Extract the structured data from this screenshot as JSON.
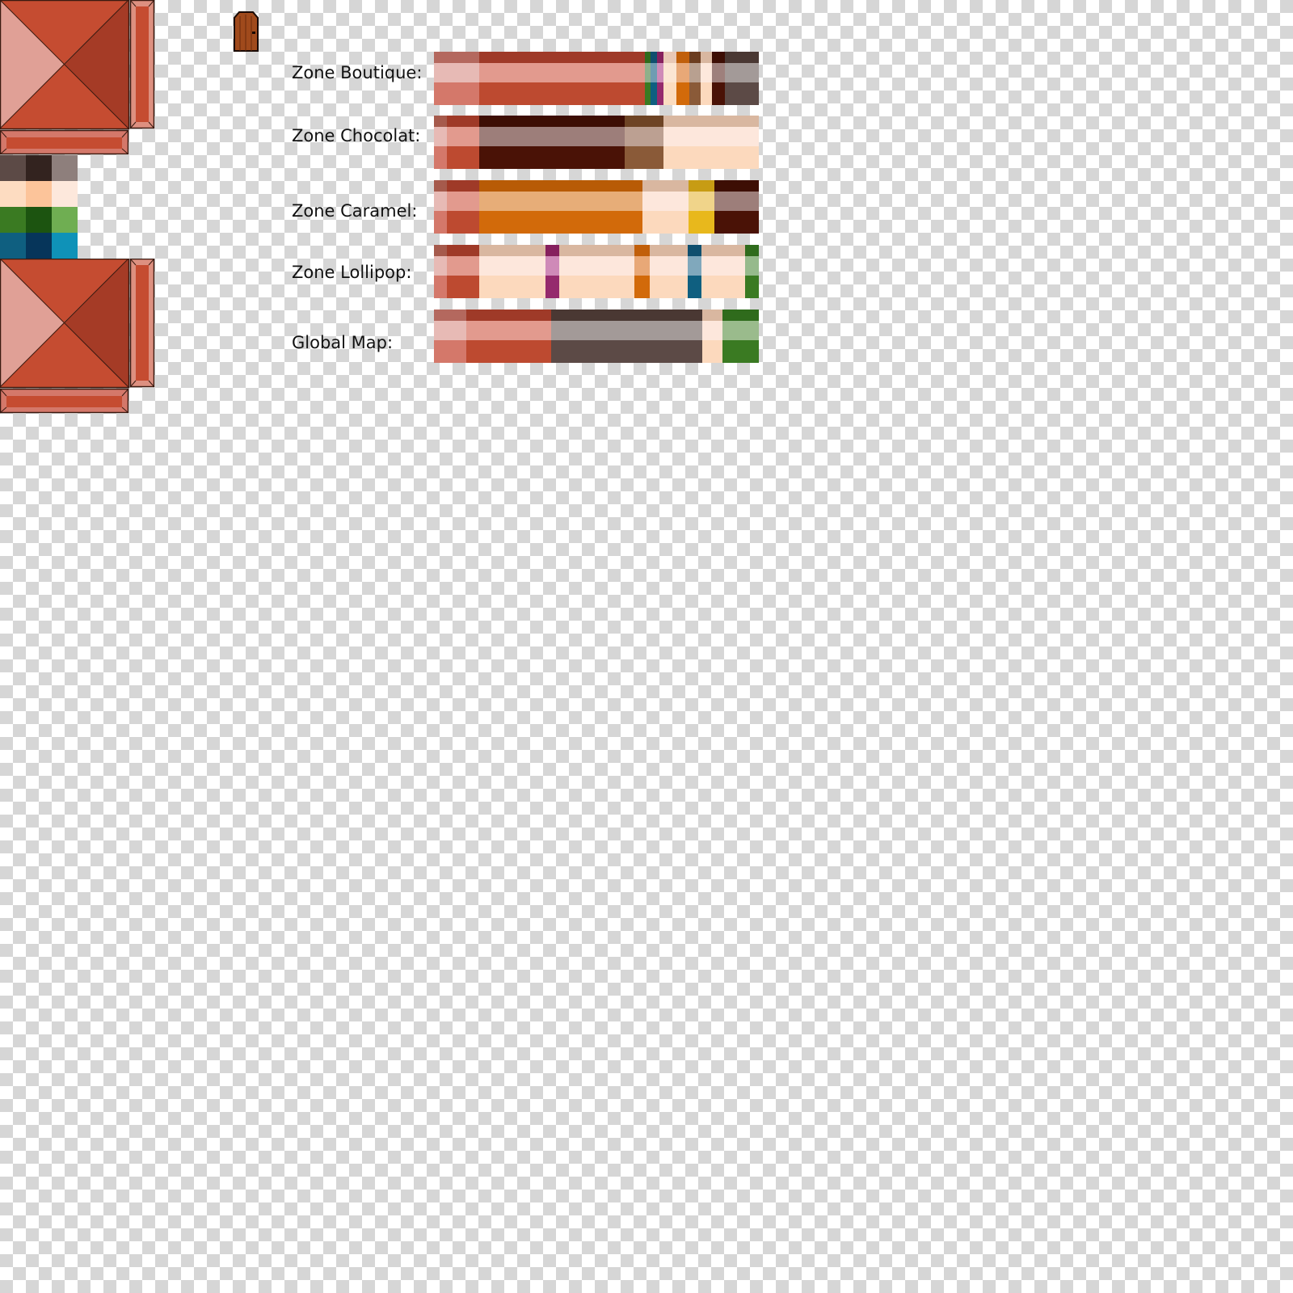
{
  "zones": [
    {
      "label": "Zone Boutique:",
      "segments": [
        {
          "w": 56,
          "top": "#b4685e",
          "mid": "#e7bab5",
          "bot": "#d4786a"
        },
        {
          "w": 205,
          "top": "#9f3a28",
          "mid": "#e29a8e",
          "bot": "#bd4a30"
        },
        {
          "w": 7,
          "top": "#2f6b1c",
          "mid": "#8fb08a",
          "bot": "#3a7a22"
        },
        {
          "w": 8,
          "top": "#0f4f6e",
          "mid": "#6f9cb2",
          "bot": "#0f5f80"
        },
        {
          "w": 8,
          "top": "#86205e",
          "mid": "#cf8ab8",
          "bot": "#952a6d"
        },
        {
          "w": 16,
          "top": "#e8c8b6",
          "mid": "#fbe5d3",
          "bot": "#fbdcc0"
        },
        {
          "w": 16,
          "top": "#c15f0a",
          "mid": "#e8a877",
          "bot": "#d26a0a"
        },
        {
          "w": 14,
          "top": "#6b3d20",
          "mid": "#b8a090",
          "bot": "#8a5a38"
        },
        {
          "w": 14,
          "top": "#d9b7a0",
          "mid": "#fde8dc",
          "bot": "#fcd9bd"
        },
        {
          "w": 16,
          "top": "#3d0e04",
          "mid": "#9e807c",
          "bot": "#4a1206"
        },
        {
          "w": 42,
          "top": "#4a3833",
          "mid": "#a39a98",
          "bot": "#5c4a46"
        }
      ]
    },
    {
      "label": "Zone Chocolat:",
      "segments": [
        {
          "w": 16,
          "top": "#a65a4c",
          "mid": "#e7bab5",
          "bot": "#d4786a"
        },
        {
          "w": 40,
          "top": "#9f3a28",
          "mid": "#e29a8e",
          "bot": "#bd4a30"
        },
        {
          "w": 180,
          "top": "#3d0e04",
          "mid": "#9d7e7a",
          "bot": "#4a1206"
        },
        {
          "w": 48,
          "top": "#6e4425",
          "mid": "#bca092",
          "bot": "#8a5a38"
        },
        {
          "w": 118,
          "top": "#d9b7a0",
          "mid": "#fde7dc",
          "bot": "#fcd9bd"
        }
      ]
    },
    {
      "label": "Zone Caramel:",
      "segments": [
        {
          "w": 16,
          "top": "#a65a4c",
          "mid": "#e7bab5",
          "bot": "#d4786a"
        },
        {
          "w": 40,
          "top": "#9f3a28",
          "mid": "#e29a8e",
          "bot": "#bd4a30"
        },
        {
          "w": 202,
          "top": "#b85b06",
          "mid": "#e7ad78",
          "bot": "#d26a0a"
        },
        {
          "w": 57,
          "top": "#d9b7a0",
          "mid": "#fde7dc",
          "bot": "#fcd9bd"
        },
        {
          "w": 32,
          "top": "#c79c14",
          "mid": "#f0d48a",
          "bot": "#e8b81c"
        },
        {
          "w": 55,
          "top": "#3d0e04",
          "mid": "#9d7e7a",
          "bot": "#4a1206"
        }
      ]
    },
    {
      "label": "Zone Lollipop:",
      "segments": [
        {
          "w": 16,
          "top": "#a65a4c",
          "mid": "#e7bab5",
          "bot": "#d4786a"
        },
        {
          "w": 40,
          "top": "#9f3a28",
          "mid": "#e29a8e",
          "bot": "#bd4a30"
        },
        {
          "w": 82,
          "top": "#d9b7a0",
          "mid": "#fde7dc",
          "bot": "#fcd9bd"
        },
        {
          "w": 17,
          "top": "#86205e",
          "mid": "#cf8ab8",
          "bot": "#952a6d"
        },
        {
          "w": 93,
          "top": "#d9b7a0",
          "mid": "#fde7dc",
          "bot": "#fcd9bd"
        },
        {
          "w": 19,
          "top": "#c15f0a",
          "mid": "#e8a877",
          "bot": "#d26a0a"
        },
        {
          "w": 47,
          "top": "#d9b7a0",
          "mid": "#fde7dc",
          "bot": "#fcd9bd"
        },
        {
          "w": 17,
          "top": "#0f4f6e",
          "mid": "#80a8bc",
          "bot": "#0f5f80"
        },
        {
          "w": 54,
          "top": "#d9b7a0",
          "mid": "#fde7dc",
          "bot": "#fcd9bd"
        },
        {
          "w": 17,
          "top": "#2f6b1c",
          "mid": "#96ba8c",
          "bot": "#3a7a22"
        }
      ]
    },
    {
      "label": "Global Map:",
      "segments": [
        {
          "w": 40,
          "top": "#b4685e",
          "mid": "#e7bab5",
          "bot": "#d4786a"
        },
        {
          "w": 105,
          "top": "#9f3a28",
          "mid": "#e29a8e",
          "bot": "#bd4a30"
        },
        {
          "w": 187,
          "top": "#4a3833",
          "mid": "#a39a98",
          "bot": "#5c4a46"
        },
        {
          "w": 25,
          "top": "#d9b7a0",
          "mid": "#fde7dc",
          "bot": "#fcd9bd"
        },
        {
          "w": 45,
          "top": "#2f6b1c",
          "mid": "#9abb8c",
          "bot": "#3a7a22"
        }
      ]
    }
  ],
  "palette": [
    [
      "#5c4a46",
      "#33231f",
      "#8e7f7c"
    ],
    [
      "#fddcc1",
      "#fcc49a",
      "#fde8dc"
    ],
    [
      "#3a7a22",
      "#1c5410",
      "#6fae52"
    ],
    [
      "#0f5f80",
      "#06355a",
      "#0f92b8"
    ]
  ],
  "tile": {
    "left": "#e0a096",
    "top": "#c54c31",
    "right": "#a53b26",
    "bottom": "#c54c31",
    "side_light": "#dd9080",
    "side_dark": "#c54c31",
    "bar": "#c54c31",
    "bar_light": "#d4786a"
  },
  "door": {
    "fill": "#a04a1c",
    "icon": "door-icon"
  }
}
